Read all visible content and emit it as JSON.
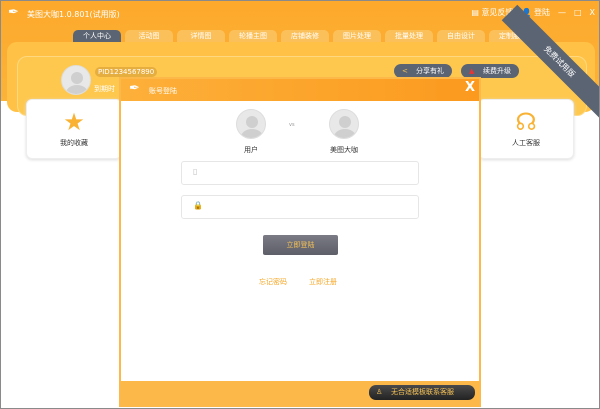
{
  "app": {
    "title": "美图大咖1.0.801(试用版)",
    "feedback": "意见反馈",
    "login": "登陆",
    "minimize": "—",
    "maximize": "□",
    "close": "X"
  },
  "tabs": [
    "个人中心",
    "活动图",
    "详情图",
    "轮播主图",
    "店铺装修",
    "图片处理",
    "批量处理",
    "自由设计",
    "定制服务"
  ],
  "profile": {
    "pid": "PID1234567890",
    "expire": "到期时",
    "share": "分享有礼",
    "renew": "续费升级",
    "ribbon": "免费试用版"
  },
  "cards": {
    "favorites": "我的收藏",
    "service": "人工客服"
  },
  "modal": {
    "title": "账号登陆",
    "close": "X",
    "account1": "用户",
    "vs": "vs",
    "account2": "美图大咖",
    "phone_placeholder": "",
    "password_placeholder": "",
    "login_button": "立即登陆",
    "forgot": "忘记密码",
    "register": "立即注册",
    "contact": "无合适模板联系客服"
  },
  "colors": {
    "accent": "#fdb03a",
    "dark": "#5b6473"
  }
}
